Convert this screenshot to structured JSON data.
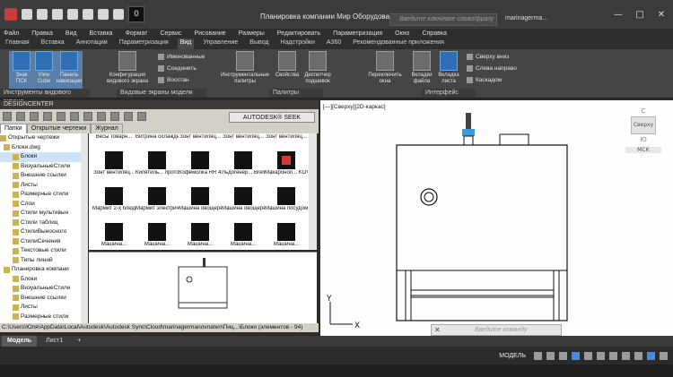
{
  "titlebar": {
    "quick_number": "0",
    "title": "Планировка компании Мир Оборудования (...",
    "search_placeholder": "Введите ключевое слово/фразу",
    "user": "marinagerma...",
    "controls": [
      "—",
      "□",
      "✕"
    ]
  },
  "menu": [
    "Файл",
    "Правка",
    "Вид",
    "Вставка",
    "Формат",
    "Сервис",
    "Рисование",
    "Размеры",
    "Редактировать",
    "Параметризация",
    "Окно",
    "Справка"
  ],
  "ribbon_tabs": [
    "Главная",
    "Вставка",
    "Аннотации",
    "Параметризация",
    "Вид",
    "Управление",
    "Вывод",
    "Надстройки",
    "A360",
    "Рекомендованные приложения"
  ],
  "ribbon_active_tab": "Вид",
  "ribbon": {
    "znak_psk": "Знак ПСК",
    "view_cube": "View Cube",
    "nav_panel": "Панель навигации",
    "config": "Конфигурация видового экрана",
    "rename": "Именованные",
    "join": "Соединить",
    "restore": "Восстан",
    "tool_palettes": "Инструментальные палитры",
    "properties": "Свойства",
    "dispatcher": "Диспетчер подшивок",
    "switch_window": "Переключить окна",
    "file_tabs": "Вкладки файла",
    "layout_tabs": "Вкладка листа",
    "cascade_down": "Сверху вниз",
    "left_right": "Слева направо",
    "cascade": "Каскадом",
    "group_tools": "Инструменты видового экрана",
    "group_models": "Видовые экраны модели",
    "group_palettes": "Палитры",
    "group_interface": "Интерфейс"
  },
  "designcenter": {
    "title": "DESIGNCENTER",
    "seek": "AUTODESK® SEEK",
    "tabs": [
      "Папки",
      "Открытые чертежи",
      "Журнал"
    ],
    "tree_header": "Открытые чертежи",
    "tree": [
      {
        "label": "Блоки.dwg",
        "lvl": 1
      },
      {
        "label": "Блоки",
        "lvl": 2
      },
      {
        "label": "ВизуальныеСтили",
        "lvl": 2
      },
      {
        "label": "Внешние ссылки",
        "lvl": 2
      },
      {
        "label": "Листы",
        "lvl": 2
      },
      {
        "label": "Размерные стили",
        "lvl": 2
      },
      {
        "label": "Слои",
        "lvl": 2
      },
      {
        "label": "Стили мультивын",
        "lvl": 2
      },
      {
        "label": "Стили таблиц",
        "lvl": 2
      },
      {
        "label": "СтилиВыносного",
        "lvl": 2
      },
      {
        "label": "СтилиСечения",
        "lvl": 2
      },
      {
        "label": "Текстовые стили",
        "lvl": 2
      },
      {
        "label": "Типы линий",
        "lvl": 2
      },
      {
        "label": "Планировка компани",
        "lvl": 1
      },
      {
        "label": "Блоки",
        "lvl": 2
      },
      {
        "label": "ВизуальныеСтили",
        "lvl": 2
      },
      {
        "label": "Внешние ссылки",
        "lvl": 2
      },
      {
        "label": "Листы",
        "lvl": 2
      },
      {
        "label": "Размерные стили",
        "lvl": 2
      }
    ],
    "grid_top_captions": [
      "Весы товарн...",
      "Витрина охлажде...",
      "Зонт вентиляц...",
      "Зонт вентиляц...",
      "Зонт вентиляц..."
    ],
    "grid": [
      {
        "cap": "Зонт вентиляц..."
      },
      {
        "cap": "Кипятиль... проточны..."
      },
      {
        "cap": "Кофемолка RR 45-S-E"
      },
      {
        "cap": "Льдогенер... Brema CB 4..."
      },
      {
        "cap": "Макароноп... KOVINAST..."
      },
      {
        "cap": "Мармит 2-х блюд ЧТТ..."
      },
      {
        "cap": "Мармит электриче..."
      },
      {
        "cap": "Машина овощереза..."
      },
      {
        "cap": "Машина овощерез..."
      },
      {
        "cap": "Машина посудомо..."
      },
      {
        "cap": "Машина..."
      },
      {
        "cap": "Машина..."
      },
      {
        "cap": "Машина..."
      },
      {
        "cap": "Машина..."
      },
      {
        "cap": "Машина..."
      }
    ],
    "status": "C:\\Users\\Юля\\AppData\\Local\\Autodesk\\Autodesk Sync\\Cloud\\marinagermanovnaten\\Пиц...\\Блоки (элементов - 94)"
  },
  "viewport": {
    "label": "[—][Сверху][2D-каркас]",
    "viewcube_top": "С",
    "viewcube_face": "Сверху",
    "viewcube_bottom": "Ю",
    "wcs": "МСК",
    "ucs_y": "Y",
    "ucs_x": "X",
    "command_placeholder": "Введите команду"
  },
  "layout_tabs": [
    "Модель",
    "Лист1",
    "+"
  ],
  "status": {
    "model": "МОДЕЛЬ"
  }
}
